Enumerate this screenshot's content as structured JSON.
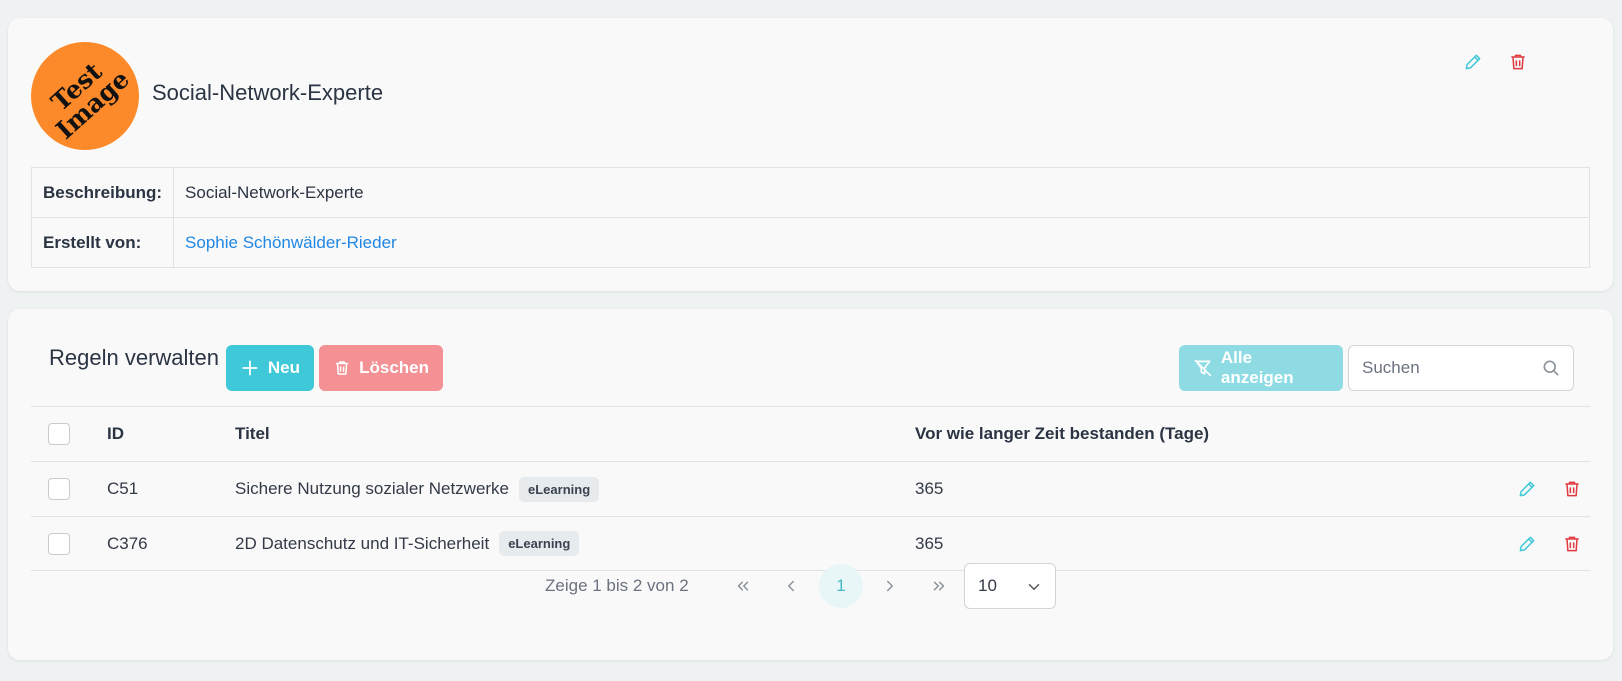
{
  "profile": {
    "avatar_text": "Test Image",
    "title": "Social-Network-Experte",
    "fields": [
      {
        "label": "Beschreibung:",
        "value": "Social-Network-Experte"
      },
      {
        "label": "Erstellt von:",
        "value": "Sophie Schönwälder-Rieder"
      }
    ]
  },
  "rules": {
    "title": "Regeln verwalten",
    "new_label": "Neu",
    "delete_label": "Löschen",
    "show_all_label": "Alle anzeigen",
    "search_placeholder": "Suchen",
    "columns": [
      "ID",
      "Titel",
      "Vor wie langer Zeit bestanden (Tage)"
    ],
    "rows": [
      {
        "id": "C51",
        "title": "Sichere Nutzung sozialer Netzwerke",
        "tag": "eLearning",
        "days": "365"
      },
      {
        "id": "C376",
        "title": "2D Datenschutz und IT-Sicherheit",
        "tag": "eLearning",
        "days": "365"
      }
    ]
  },
  "pagination": {
    "info": "Zeige 1 bis 2 von 2",
    "current_page": "1",
    "per_page": "10"
  },
  "colors": {
    "accent": "#3fc8d8",
    "danger": "#e0393e",
    "link": "#1f87e5",
    "avatar": "#fd8a2a"
  },
  "icons": [
    "edit-pencil-icon",
    "trash-icon",
    "plus-icon",
    "filter-off-icon",
    "search-icon",
    "chevron-double-left-icon",
    "chevron-left-icon",
    "chevron-right-icon",
    "chevron-double-right-icon",
    "chevron-down-icon"
  ]
}
